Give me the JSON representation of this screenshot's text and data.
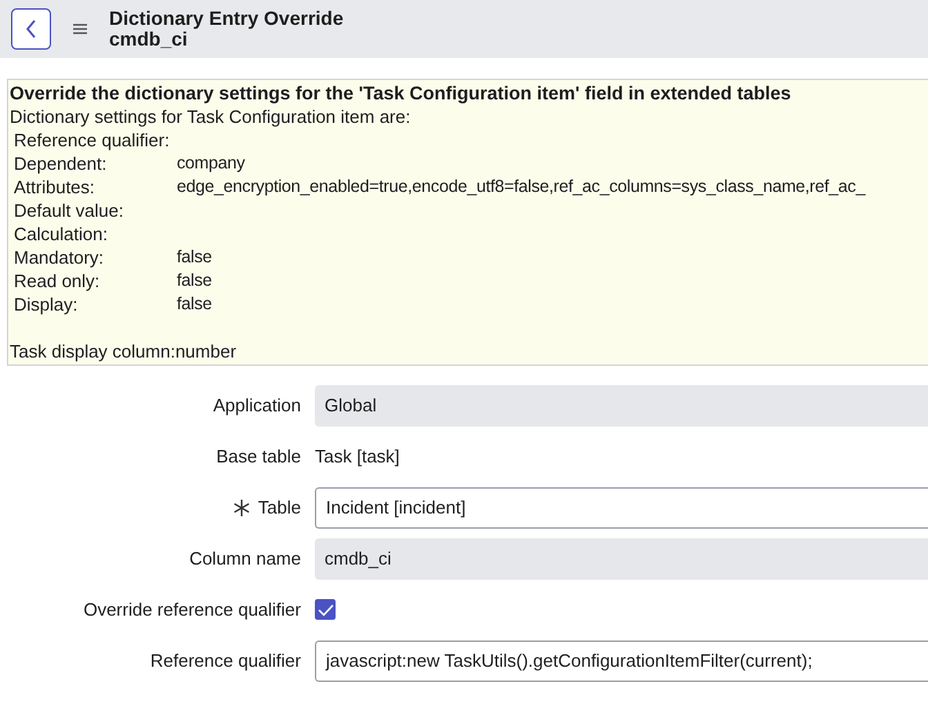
{
  "header": {
    "title": "Dictionary Entry Override",
    "subtitle": "cmdb_ci"
  },
  "info": {
    "heading": "Override the dictionary settings for the 'Task Configuration item' field in extended tables",
    "intro": "Dictionary settings for Task Configuration item are:",
    "settings": [
      {
        "label": "Reference qualifier:"
      },
      {
        "label": "Dependent:",
        "value": "company"
      },
      {
        "label": "Attributes:",
        "value": "edge_encryption_enabled=true,encode_utf8=false,ref_ac_columns=sys_class_name,ref_ac_"
      },
      {
        "label": "Default value:"
      },
      {
        "label": "Calculation:"
      },
      {
        "label": "Mandatory:",
        "value": "false"
      },
      {
        "label": "Read only:",
        "value": "false"
      },
      {
        "label": "Display:",
        "value": "false"
      }
    ],
    "footer": "Task display column:number"
  },
  "form": {
    "fields": [
      {
        "kind": "readonly",
        "label": "Application",
        "value": "Global",
        "mandatory": false
      },
      {
        "kind": "text",
        "label": "Base table",
        "value": "Task [task]",
        "mandatory": false
      },
      {
        "kind": "input",
        "label": "Table",
        "value": "Incident [incident]",
        "mandatory": true
      },
      {
        "kind": "readonly",
        "label": "Column name",
        "value": "cmdb_ci",
        "mandatory": false
      },
      {
        "kind": "checkbox",
        "label": "Override reference qualifier",
        "checked": true,
        "mandatory": false
      },
      {
        "kind": "input",
        "label": "Reference qualifier",
        "value": "javascript:new TaskUtils().getConfigurationItemFilter(current);",
        "mandatory": false
      }
    ]
  }
}
